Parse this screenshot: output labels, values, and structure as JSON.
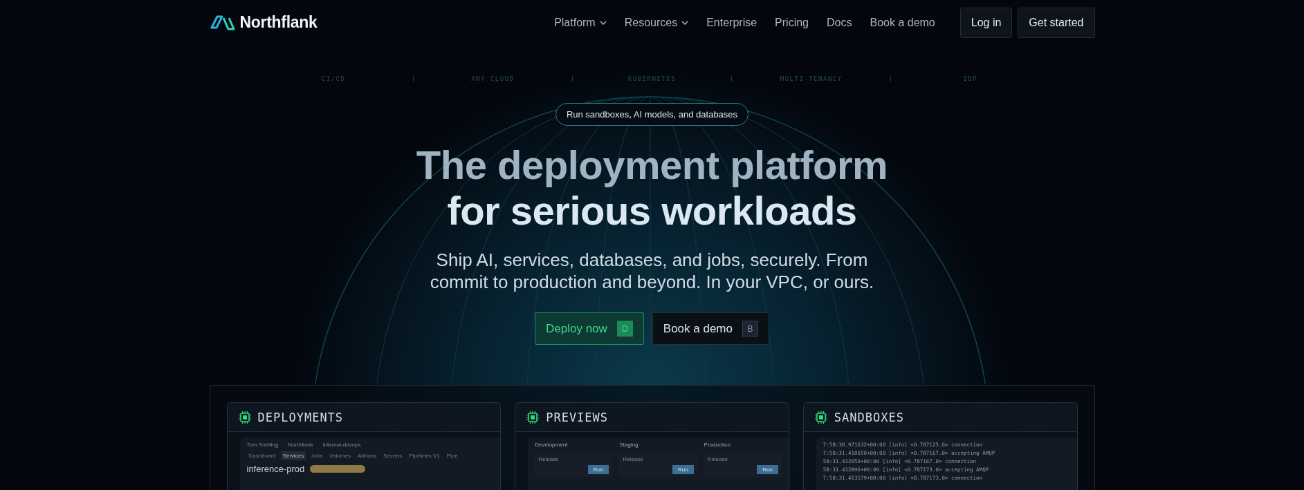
{
  "header": {
    "logo": "Northflank",
    "nav": [
      {
        "label": "Platform",
        "dropdown": true
      },
      {
        "label": "Resources",
        "dropdown": true
      },
      {
        "label": "Enterprise",
        "dropdown": false
      },
      {
        "label": "Pricing",
        "dropdown": false
      },
      {
        "label": "Docs",
        "dropdown": false
      },
      {
        "label": "Book a demo",
        "dropdown": false
      }
    ],
    "buttons": [
      {
        "label": "Log in"
      },
      {
        "label": "Get started"
      }
    ]
  },
  "topics": [
    "CI/CD",
    "ANY CLOUD",
    "KUBERNETES",
    "MULTI-TENANCY",
    "IDP"
  ],
  "hero": {
    "pill": "Run sandboxes, AI models, and databases",
    "title_lines": [
      "The deployment platform",
      "for serious workloads"
    ],
    "subtitle_lines": [
      "Ship AI, services, databases, and jobs, securely. From",
      "commit to production and beyond. In your VPC, or ours."
    ],
    "buttons": [
      {
        "label": "Deploy now",
        "key": "D",
        "kind": "primary"
      },
      {
        "label": "Book a demo",
        "key": "B",
        "kind": "secondary"
      }
    ]
  },
  "cards": [
    {
      "title": "DEPLOYMENTS",
      "kind": "dashboard",
      "crumbs": [
        "Tom Snelling",
        "Northflank",
        "internal-devops"
      ],
      "tabs": [
        {
          "label": "Dashboard",
          "selected": false
        },
        {
          "label": "Services",
          "selected": true
        },
        {
          "label": "Jobs",
          "selected": false
        },
        {
          "label": "Volumes",
          "selected": false
        },
        {
          "label": "Addons",
          "selected": false
        },
        {
          "label": "Secrets",
          "selected": false
        },
        {
          "label": "Pipelines V1",
          "selected": false
        },
        {
          "label": "Pipe",
          "selected": false
        }
      ],
      "service": "inference-prod"
    },
    {
      "title": "PREVIEWS",
      "kind": "pipeline",
      "stages": [
        {
          "name": "Development",
          "release": "Release",
          "action": "Run"
        },
        {
          "name": "Staging",
          "release": "Release",
          "action": "Run"
        },
        {
          "name": "Production",
          "release": "Release",
          "action": "Run"
        }
      ]
    },
    {
      "title": "SANDBOXES",
      "kind": "logs",
      "lines": [
        "7:58:30.971632+00:00 [info] <0.787125.0> connection",
        "7:58:31.410650+00:00 [info] <0.787167.0> accepting AMQP",
        "58:31.412050+00:00 [info] <0.787167.0> connection",
        "58:31.412896+00:00 [info] <0.787173.0> accepting AMQP",
        "7:58:31.413179+00:00 [info] <0.787173.0> connection"
      ]
    }
  ]
}
